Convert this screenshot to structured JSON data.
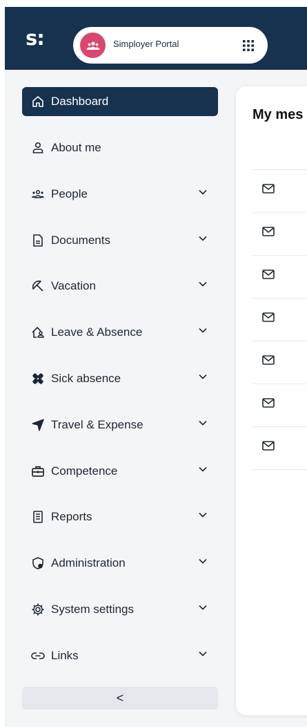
{
  "header": {
    "logo_text": "s:",
    "portal_name": "Simployer Portal",
    "brand_color": "#17324f",
    "avatar_color": "#d9476e"
  },
  "sidebar": {
    "items": [
      {
        "label": "Dashboard",
        "icon": "home-icon",
        "active": true,
        "expandable": false
      },
      {
        "label": "About me",
        "icon": "user-icon",
        "active": false,
        "expandable": false
      },
      {
        "label": "People",
        "icon": "people-icon",
        "active": false,
        "expandable": true
      },
      {
        "label": "Documents",
        "icon": "document-icon",
        "active": false,
        "expandable": true
      },
      {
        "label": "Vacation",
        "icon": "beach-umbrella-icon",
        "active": false,
        "expandable": true
      },
      {
        "label": "Leave & Absence",
        "icon": "leave-home-icon",
        "active": false,
        "expandable": true
      },
      {
        "label": "Sick absence",
        "icon": "bandage-icon",
        "active": false,
        "expandable": true
      },
      {
        "label": "Travel & Expense",
        "icon": "airplane-icon",
        "active": false,
        "expandable": true
      },
      {
        "label": "Competence",
        "icon": "briefcase-icon",
        "active": false,
        "expandable": true
      },
      {
        "label": "Reports",
        "icon": "report-icon",
        "active": false,
        "expandable": true
      },
      {
        "label": "Administration",
        "icon": "admin-shield-icon",
        "active": false,
        "expandable": true
      },
      {
        "label": "System settings",
        "icon": "gear-icon",
        "active": false,
        "expandable": true
      },
      {
        "label": "Links",
        "icon": "link-icon",
        "active": false,
        "expandable": true
      }
    ],
    "collapse_label": "<"
  },
  "main": {
    "title": "My mes",
    "message_rows": 7
  }
}
